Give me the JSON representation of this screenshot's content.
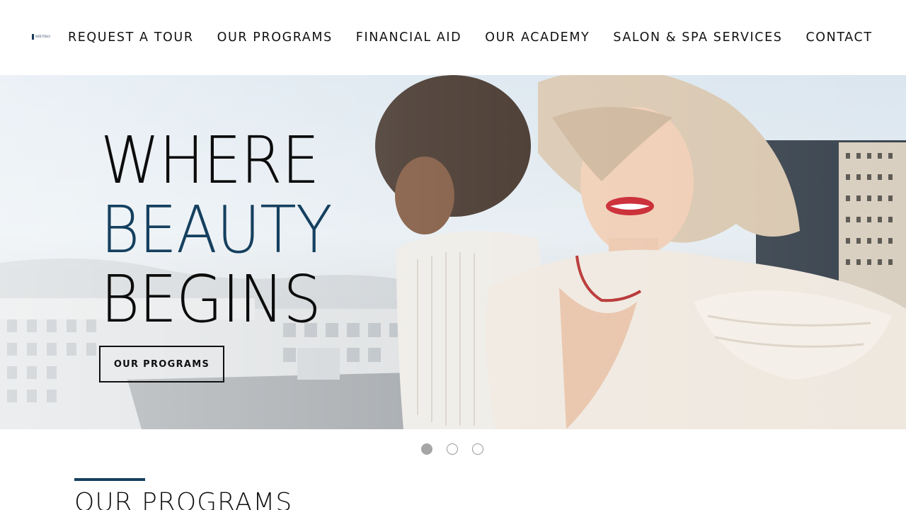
{
  "header": {
    "logo_text": "METRO",
    "nav": [
      {
        "label": "REQUEST A TOUR"
      },
      {
        "label": "OUR PROGRAMS"
      },
      {
        "label": "FINANCIAL AID"
      },
      {
        "label": "OUR ACADEMY"
      },
      {
        "label": "SALON & SPA SERVICES"
      },
      {
        "label": "CONTACT"
      }
    ]
  },
  "hero": {
    "headline": {
      "line1": "WHERE",
      "line2": "BEAUTY",
      "line3": "BEGINS"
    },
    "cta_label": "OUR PROGRAMS",
    "slide_count": 3,
    "active_slide": 1
  },
  "section": {
    "title": "OUR PROGRAMS"
  },
  "colors": {
    "accent": "#15405f",
    "text": "#111111",
    "dot_active": "#a6a6a6"
  },
  "icons": [
    "logo-mark-icon"
  ]
}
